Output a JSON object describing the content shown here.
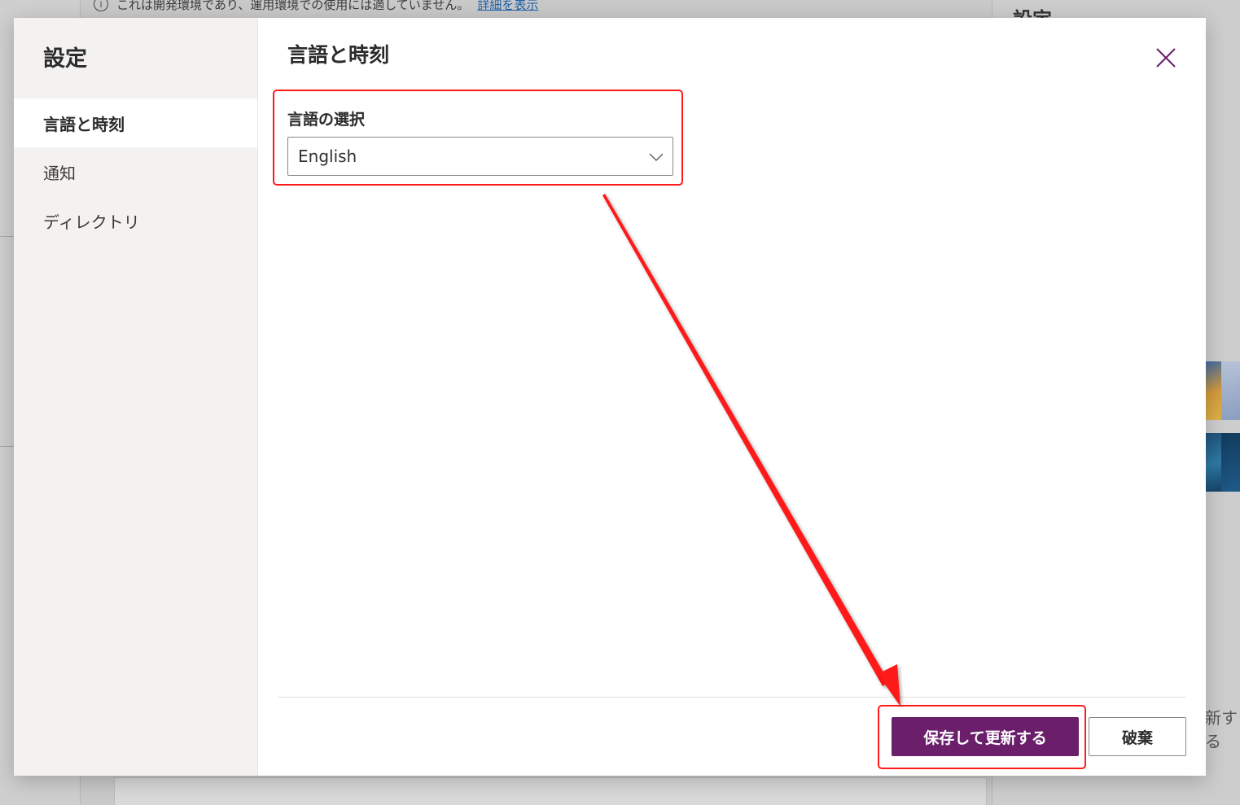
{
  "background": {
    "banner_text": "これは開発環境であり、運用環境での使用には適していません。",
    "banner_link": "詳細を表示",
    "right_title": "設定",
    "right_snippet": "新する"
  },
  "dialog": {
    "sidebar": {
      "title": "設定",
      "items": [
        {
          "label": "言語と時刻",
          "active": true
        },
        {
          "label": "通知",
          "active": false
        },
        {
          "label": "ディレクトリ",
          "active": false
        }
      ]
    },
    "main": {
      "title": "言語と時刻",
      "language_field": {
        "label": "言語の選択",
        "value": "English"
      }
    },
    "footer": {
      "save_label": "保存して更新する",
      "discard_label": "破棄"
    }
  },
  "colors": {
    "primary_button": "#6b1f6b",
    "close_icon": "#6b1f6b",
    "annotation": "#ff1a1a"
  },
  "icons": {
    "close": "close-icon",
    "dropdown": "chevron-down-icon",
    "info": "info-icon"
  }
}
